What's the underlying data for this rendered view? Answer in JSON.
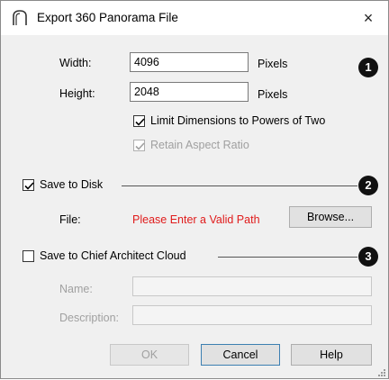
{
  "window": {
    "title": "Export 360 Panorama File",
    "icon": "chief-architect-arch-icon",
    "close_label": "×"
  },
  "size": {
    "width_label": "Width:",
    "width_value": "4096",
    "width_unit": "Pixels",
    "height_label": "Height:",
    "height_value": "2048",
    "height_unit": "Pixels",
    "limit_powers_label": "Limit Dimensions to Powers of Two",
    "limit_powers_checked": true,
    "retain_aspect_label": "Retain Aspect Ratio",
    "retain_aspect_checked": true,
    "retain_aspect_enabled": false
  },
  "disk": {
    "label": "Save to Disk",
    "checked": true,
    "file_label": "File:",
    "file_error": "Please Enter a Valid Path",
    "browse_label": "Browse..."
  },
  "cloud": {
    "label": "Save to Chief Architect Cloud",
    "checked": false,
    "name_label": "Name:",
    "name_value": "",
    "description_label": "Description:",
    "description_value": ""
  },
  "callouts": [
    "1",
    "2",
    "3"
  ],
  "buttons": {
    "ok": "OK",
    "cancel": "Cancel",
    "help": "Help"
  },
  "colors": {
    "error": "#e01b1b",
    "dialog_bg": "#f0f0f0",
    "callout_bg": "#111111"
  }
}
